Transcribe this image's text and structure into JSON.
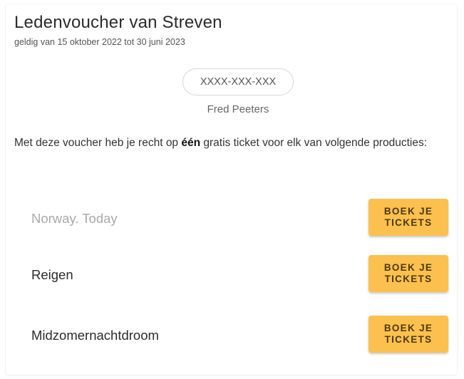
{
  "voucher": {
    "title": "Ledenvoucher van Streven",
    "validity": "geldig van 15 oktober 2022 tot 30 juni 2023",
    "code": "XXXX-XXX-XXX",
    "holder": "Fred Peeters",
    "description_before": "Met deze voucher heb je recht op ",
    "description_bold": "één",
    "description_after": " gratis ticket voor elk van volgende producties:"
  },
  "productions": [
    {
      "name": "Norway. Today",
      "button_label": "BOEK JE TICKETS",
      "muted": true
    },
    {
      "name": "Reigen",
      "button_label": "BOEK JE TICKETS",
      "muted": false
    },
    {
      "name": "Midzomernachtdroom",
      "button_label": "BOEK JE TICKETS",
      "muted": false
    }
  ],
  "colors": {
    "button": "#fbc04d",
    "muted_text": "#aaaaaa"
  }
}
